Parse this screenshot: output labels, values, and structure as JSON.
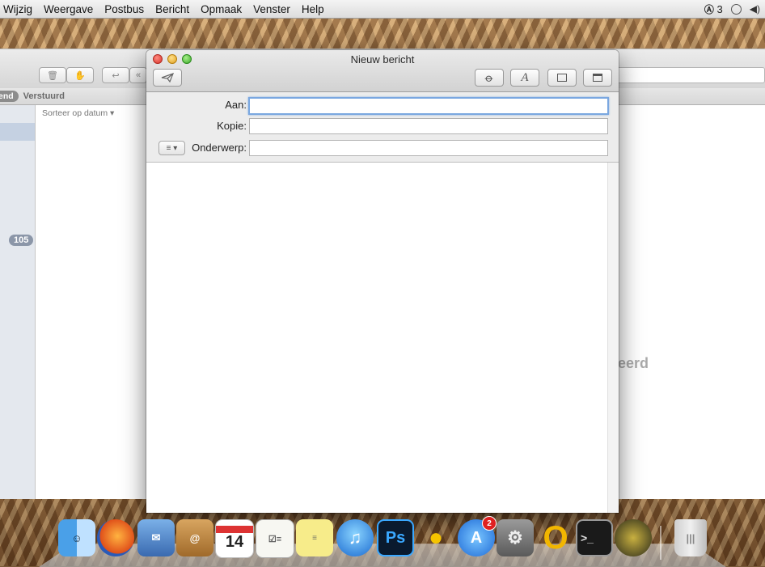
{
  "menubar": {
    "items": [
      "Wijzig",
      "Weergave",
      "Postbus",
      "Bericht",
      "Opmaak",
      "Venster",
      "Help"
    ],
    "status_number": "3",
    "status_icons": [
      "adobe-icon",
      "time-machine-icon",
      "speaker-icon"
    ]
  },
  "mail_main": {
    "favorites": {
      "active": "end",
      "sent": "Verstuurd"
    },
    "sort_label": "Sorteer op datum ▾",
    "unread_count": "105",
    "preview_fragment": "eerd"
  },
  "compose": {
    "title": "Nieuw bericht",
    "fields": {
      "to_label": "Aan:",
      "to_value": "",
      "cc_label": "Kopie:",
      "cc_value": "",
      "subject_label": "Onderwerp:",
      "subject_value": ""
    },
    "format_menu": "≡ ▾",
    "toolbar": {
      "send": "send-icon",
      "attach": "paperclip-icon",
      "fonts_label": "A",
      "photo": "photo-browser-icon",
      "stationery": "stationery-icon"
    },
    "calendar_day": "14"
  },
  "dock": {
    "apps": [
      "Finder",
      "Firefox",
      "Mail",
      "Contacts",
      "Calendar",
      "Reminders",
      "Notes",
      "iTunes",
      "Photoshop",
      "Cyberduck",
      "App Store",
      "System Preferences",
      "Opera",
      "Terminal",
      "Radar",
      "Trash"
    ],
    "appstore_badge": "2",
    "photoshop_label": "Ps",
    "calendar_day": "14"
  },
  "colors": {
    "accent_focus": "#7aa7e0",
    "close": "#d8342a",
    "minimize": "#e0a020",
    "zoom": "#3ca82a"
  }
}
